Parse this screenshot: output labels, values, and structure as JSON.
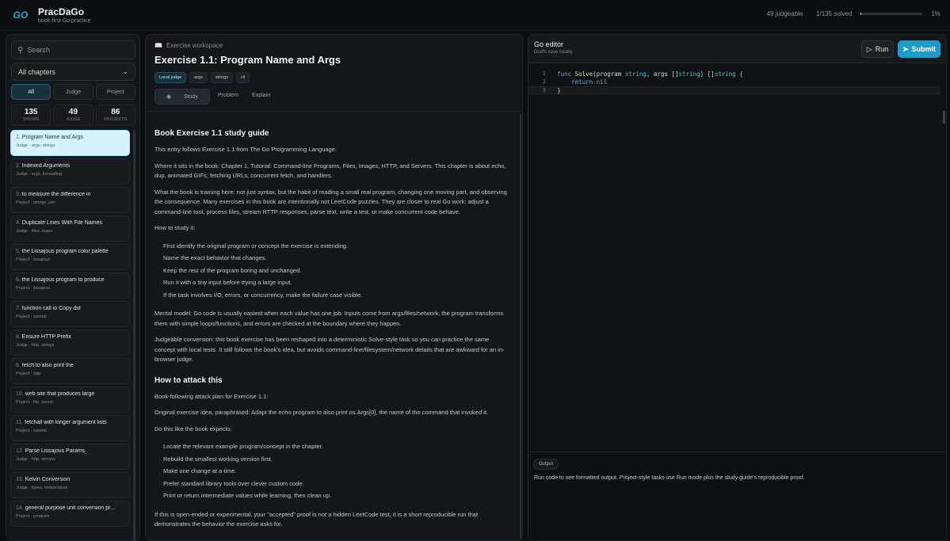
{
  "header": {
    "logo_text": "GO",
    "title": "PracDaGo",
    "subtitle": "book-first Go practice",
    "judgeable": "49 judgeable",
    "solved": "1/135 solved",
    "progress_pct": 1,
    "progress_label": "1%"
  },
  "sidebar": {
    "search_placeholder": "Search",
    "chapter_select": "All chapters",
    "filters": [
      "All",
      "Judge",
      "Project"
    ],
    "counts": [
      {
        "value": "135",
        "label": "SHOWN"
      },
      {
        "value": "49",
        "label": "JUDGE"
      },
      {
        "value": "86",
        "label": "PROJECTS"
      }
    ],
    "items": [
      {
        "num": "1.",
        "name": "Program Name and Args",
        "meta": "Judge · args, strings"
      },
      {
        "num": "2.",
        "name": "Indexed Arguments",
        "meta": "Judge · args, formatting"
      },
      {
        "num": "3.",
        "name": "to measure the difference in",
        "meta": "Project · strings, join"
      },
      {
        "num": "4.",
        "name": "Duplicate Lines With File Names",
        "meta": "Judge · files, maps"
      },
      {
        "num": "5.",
        "name": "the Lissajous program color palette",
        "meta": "Project · lissajous"
      },
      {
        "num": "6.",
        "name": "the Lissajous program to produce",
        "meta": "Project · lissajous"
      },
      {
        "num": "7.",
        "name": "function call io Copy dst",
        "meta": "Project · tutorial"
      },
      {
        "num": "8.",
        "name": "Ensure HTTP Prefix",
        "meta": "Judge · http, strings"
      },
      {
        "num": "9.",
        "name": "fetch to also print the",
        "meta": "Project · http"
      },
      {
        "num": "10.",
        "name": "web site that produces large",
        "meta": "Project · file, server"
      },
      {
        "num": "11.",
        "name": "fetchall with longer argument lists",
        "meta": "Project · tutorial"
      },
      {
        "num": "12.",
        "name": "Parse Lissajous Params",
        "meta": "Judge · http, strconv"
      },
      {
        "num": "13.",
        "name": "Kelvin Conversion",
        "meta": "Judge · types, temperature"
      },
      {
        "num": "14.",
        "name": "general purpose unit conversion pr...",
        "meta": "Project · program"
      }
    ]
  },
  "workspace": {
    "label": "Exercise workspace",
    "title": "Exercise 1.1: Program Name and Args",
    "tags": [
      "Local judge",
      "args",
      "strings",
      "cli"
    ],
    "tabs": [
      "Study",
      "Problem",
      "Explain"
    ],
    "guide_title": "Book Exercise 1.1 study guide",
    "p1": "This entry follows Exercise 1.1 from The Go Programming Language.",
    "p2": "Where it sits in the book: Chapter 1, Tutorial: Command-line Programs, Files, Images, HTTP, and Servers. This chapter is about echo, dup, animated GIFs, fetching URLs, concurrent fetch, and handlers.",
    "p3": "What the book is training here: not just syntax, but the habit of reading a small real program, changing one moving part, and observing the consequence. Many exercises in this book are intentionally not LeetCode puzzles. They are closer to real Go work: adjust a command-line tool, process files, stream HTTP responses, parse text, write a test, or make concurrent code behave.",
    "how_study": "How to study it:",
    "study_steps": [
      "First identify the original program or concept the exercise is extending.",
      "Name the exact behavior that changes.",
      "Keep the rest of the program boring and unchanged.",
      "Run it with a tiny input before trying a large input.",
      "If the task involves I/O, errors, or concurrency, make the failure case visible."
    ],
    "p4": "Mental model: Go code is usually easiest when each value has one job. Inputs come from args/files/network, the program transforms them with simple loops/functions, and errors are checked at the boundary where they happen.",
    "p5": "Judgeable conversion: this book exercise has been reshaped into a deterministic Solve-style task so you can practice the same concept with local tests. It still follows the book's idea, but avoids command-line/filesystem/network details that are awkward for an in-browser judge.",
    "attack_title": "How to attack this",
    "p6": "Book-following attack plan for Exercise 1.1:",
    "p7": "Original exercise idea, paraphrased: Adapt the echo program to also print os.Args[0], the name of the command that invoked it.",
    "p8": "Do this like the book expects:",
    "attack_steps": [
      "Locate the relevant example program/concept in the chapter.",
      "Rebuild the smallest working version first.",
      "Make one change at a time.",
      "Prefer standard library tools over clever custom code.",
      "Print or return intermediate values while learning, then clean up."
    ],
    "p9": "If this is open-ended or experimental, your \"accepted\" proof is not a hidden LeetCode test; it is a short reproducible run that demonstrates the behavior the exercise asks for."
  },
  "editor": {
    "title": "Go editor",
    "subtitle": "Drafts save locally",
    "run_label": "Run",
    "submit_label": "Submit",
    "line_numbers": [
      "1",
      "2",
      "3"
    ],
    "code": [
      "func Solve(program string, args []string) []string {",
      "    return nil",
      "}"
    ],
    "output_label": "Output",
    "output_text": "Run code to see formatted output. Project-style tasks use Run mode plus the study guide's reproducible proof."
  },
  "colors": {
    "accent": "#1d9ccc",
    "selected_item": "#d6f3fb",
    "background": "#0b0f12"
  }
}
